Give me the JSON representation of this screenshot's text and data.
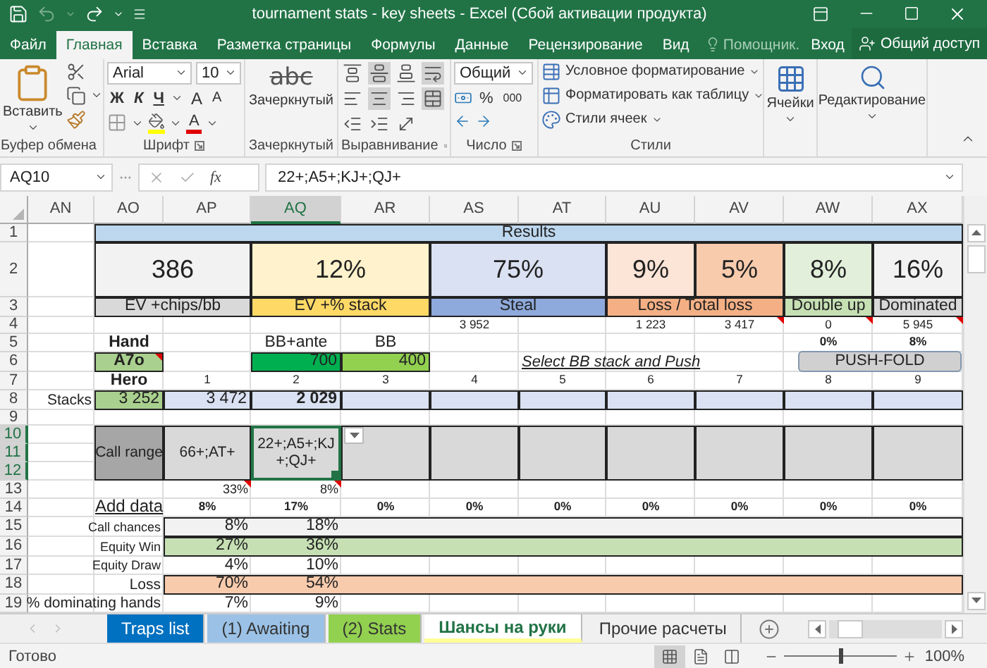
{
  "title_bar": {
    "title": "tournament stats - key sheets - Excel (Сбой активации продукта)"
  },
  "ribbon_tabs": [
    {
      "label": "Файл",
      "selected": false
    },
    {
      "label": "Главная",
      "selected": true
    },
    {
      "label": "Вставка",
      "selected": false
    },
    {
      "label": "Разметка страницы",
      "selected": false
    },
    {
      "label": "Формулы",
      "selected": false
    },
    {
      "label": "Данные",
      "selected": false
    },
    {
      "label": "Рецензирование",
      "selected": false
    },
    {
      "label": "Вид",
      "selected": false
    }
  ],
  "tell_me": "Помощник.",
  "sign_in": "Вход",
  "share": "Общий доступ",
  "ribbon_groups": [
    {
      "kind": "clipboard",
      "label": "Буфер обмена",
      "paste": "Вставить"
    },
    {
      "kind": "font",
      "label": "Шрифт",
      "font": "Arial",
      "size": "10",
      "bold": "Ж",
      "italic": "К",
      "underline": "Ч",
      "grow": "A",
      "shrink": "A",
      "font_color": "A"
    },
    {
      "kind": "style_button",
      "label": "Зачеркнутый",
      "sample": "abc",
      "button": "Зачеркнутый"
    },
    {
      "kind": "alignment",
      "label": "Выравнивание",
      "buttons": [
        {
          "kind": "top",
          "selected": false
        },
        {
          "kind": "middle",
          "selected": true
        },
        {
          "kind": "bottom",
          "selected": false
        },
        {
          "kind": "wrap",
          "selected": true
        },
        {
          "kind": "left",
          "selected": false
        },
        {
          "kind": "center",
          "selected": true
        },
        {
          "kind": "right",
          "selected": false
        },
        {
          "kind": "merge",
          "selected": true
        },
        {
          "kind": "outdent",
          "selected": false
        },
        {
          "kind": "indent",
          "selected": false
        },
        {
          "kind": "orientation",
          "selected": false
        }
      ]
    },
    {
      "kind": "number",
      "label": "Число",
      "format": "Общий",
      "percent": "%",
      "thousands": "000"
    },
    {
      "kind": "styles",
      "label": "Стили",
      "commands": [
        "Условное форматирование",
        "Форматировать как таблицу",
        "Стили ячеек"
      ]
    },
    {
      "kind": "cells",
      "button": "Ячейки"
    },
    {
      "kind": "editing",
      "button": "Редактирование"
    }
  ],
  "formula_bar": {
    "name_box": "AQ10",
    "function_label": "fx",
    "formula": "22+;A5+;KJ+;QJ+"
  },
  "sheet": {
    "columns": [
      {
        "label": "AN",
        "selected": false
      },
      {
        "label": "AO",
        "selected": false
      },
      {
        "label": "AP",
        "selected": false
      },
      {
        "label": "AQ",
        "selected": true
      },
      {
        "label": "AR",
        "selected": false
      },
      {
        "label": "AS",
        "selected": false
      },
      {
        "label": "AT",
        "selected": false
      },
      {
        "label": "AU",
        "selected": false
      },
      {
        "label": "AV",
        "selected": false
      },
      {
        "label": "AW",
        "selected": false
      },
      {
        "label": "AX",
        "selected": false
      }
    ],
    "rows": [
      {
        "number": "1",
        "selected": false,
        "cells": [
          {
            "kind": "empty"
          },
          {
            "kind": "banner",
            "text": "Results",
            "color": "#bdd7ee"
          },
          {
            "kind": "merged"
          },
          {
            "kind": "merged"
          },
          {
            "kind": "merged"
          },
          {
            "kind": "merged"
          },
          {
            "kind": "merged"
          },
          {
            "kind": "merged"
          },
          {
            "kind": "merged"
          },
          {
            "kind": "merged"
          },
          {
            "kind": "merged"
          }
        ]
      },
      {
        "number": "2",
        "selected": false,
        "cells": [
          {
            "kind": "empty"
          },
          {
            "kind": "big",
            "text": "386",
            "color": "#f2f2f2"
          },
          {
            "kind": "merged"
          },
          {
            "kind": "big",
            "text": "12%",
            "color": "#fff2cc"
          },
          {
            "kind": "merged"
          },
          {
            "kind": "big",
            "text": "75%",
            "color": "#d9e1f2"
          },
          {
            "kind": "merged"
          },
          {
            "kind": "big",
            "text": "9%",
            "color": "#fce4d6"
          },
          {
            "kind": "big",
            "text": "5%",
            "color": "#f8cbad"
          },
          {
            "kind": "big",
            "text": "8%",
            "color": "#e2efda"
          },
          {
            "kind": "big",
            "text": "16%",
            "color": "#f2f2f2"
          }
        ]
      },
      {
        "number": "3",
        "selected": false,
        "cells": [
          {
            "kind": "empty"
          },
          {
            "kind": "caption",
            "text": "EV +chips/bb",
            "color": "#d9d9d9"
          },
          {
            "kind": "merged"
          },
          {
            "kind": "caption",
            "text": "EV +% stack",
            "color": "#ffd966"
          },
          {
            "kind": "merged"
          },
          {
            "kind": "caption",
            "text": "Steal",
            "color": "#8ea9db"
          },
          {
            "kind": "merged"
          },
          {
            "kind": "caption",
            "text": "Loss / Total loss",
            "color": "#f4b084"
          },
          {
            "kind": "merged"
          },
          {
            "kind": "caption",
            "text": "Double up",
            "color": "#c6e0b4"
          },
          {
            "kind": "caption",
            "text": "Dominated",
            "color": "#d9d9d9"
          }
        ]
      },
      {
        "number": "4",
        "selected": false,
        "cells": [
          {
            "kind": "empty"
          },
          {
            "kind": "empty"
          },
          {
            "kind": "empty"
          },
          {
            "kind": "empty"
          },
          {
            "kind": "empty"
          },
          {
            "kind": "num",
            "text": "3 952"
          },
          {
            "kind": "empty"
          },
          {
            "kind": "num",
            "text": "1 223"
          },
          {
            "kind": "num",
            "text": "3 417",
            "note": true
          },
          {
            "kind": "num",
            "text": "0",
            "note": true
          },
          {
            "kind": "num",
            "text": "5 945",
            "note": true
          }
        ]
      },
      {
        "number": "5",
        "selected": false,
        "cells": [
          {
            "kind": "empty"
          },
          {
            "kind": "text",
            "text": "Hand",
            "bold": true
          },
          {
            "kind": "empty"
          },
          {
            "kind": "text",
            "text": "BB+ante"
          },
          {
            "kind": "text",
            "text": "BB"
          },
          {
            "kind": "empty"
          },
          {
            "kind": "empty"
          },
          {
            "kind": "empty"
          },
          {
            "kind": "empty"
          },
          {
            "kind": "num",
            "text": "0%",
            "bold": true
          },
          {
            "kind": "num",
            "text": "8%",
            "bold": true
          }
        ]
      },
      {
        "number": "6",
        "selected": false,
        "cells": [
          {
            "kind": "empty"
          },
          {
            "kind": "entry",
            "text": "A7o",
            "color": "#a9d08e",
            "bold": true,
            "note": true
          },
          {
            "kind": "empty"
          },
          {
            "kind": "value",
            "text": "700",
            "color": "#00b050"
          },
          {
            "kind": "value",
            "text": "400",
            "color": "#92d050"
          },
          {
            "kind": "empty"
          },
          {
            "kind": "link",
            "text": "Select BB stack and Push"
          },
          {
            "kind": "merged"
          },
          {
            "kind": "merged"
          },
          {
            "kind": "button",
            "text": "PUSH-FOLD"
          },
          {
            "kind": "merged"
          }
        ]
      },
      {
        "number": "7",
        "selected": false,
        "cells": [
          {
            "kind": "empty"
          },
          {
            "kind": "text",
            "text": "Hero",
            "bold": true
          },
          {
            "kind": "num",
            "text": "1"
          },
          {
            "kind": "num",
            "text": "2"
          },
          {
            "kind": "num",
            "text": "3"
          },
          {
            "kind": "num",
            "text": "4"
          },
          {
            "kind": "num",
            "text": "5"
          },
          {
            "kind": "num",
            "text": "6"
          },
          {
            "kind": "num",
            "text": "7"
          },
          {
            "kind": "num",
            "text": "8"
          },
          {
            "kind": "num",
            "text": "9"
          }
        ]
      },
      {
        "number": "8",
        "selected": false,
        "cells": [
          {
            "kind": "label",
            "text": "Stacks"
          },
          {
            "kind": "value",
            "text": "3 252",
            "color": "#a9d08e"
          },
          {
            "kind": "value",
            "text": "3 472",
            "color": "#d9e1f2"
          },
          {
            "kind": "value",
            "text": "2 029",
            "color": "#d9e1f2",
            "bold": true
          },
          {
            "kind": "blank",
            "color": "#d9e1f2"
          },
          {
            "kind": "blank",
            "color": "#d9e1f2"
          },
          {
            "kind": "blank",
            "color": "#d9e1f2"
          },
          {
            "kind": "blank",
            "color": "#d9e1f2"
          },
          {
            "kind": "blank",
            "color": "#d9e1f2"
          },
          {
            "kind": "blank",
            "color": "#d9e1f2"
          },
          {
            "kind": "blank",
            "color": "#d9e1f2"
          }
        ]
      },
      {
        "number": "9",
        "selected": false,
        "cells": []
      },
      {
        "number": "10",
        "selected": true,
        "cells": [
          {
            "kind": "empty"
          },
          {
            "kind": "range_label",
            "text": "Call range",
            "color": "#a6a6a6"
          },
          {
            "kind": "range",
            "text": "66+;AT+",
            "color": "#d9d9d9"
          },
          {
            "kind": "range",
            "text": "22+;A5+;KJ+;QJ+",
            "color": "#d9d9d9",
            "active": true
          },
          {
            "kind": "range",
            "color": "#d9d9d9"
          },
          {
            "kind": "range",
            "color": "#d9d9d9"
          },
          {
            "kind": "range",
            "color": "#d9d9d9"
          },
          {
            "kind": "range",
            "color": "#d9d9d9"
          },
          {
            "kind": "range",
            "color": "#d9d9d9"
          },
          {
            "kind": "range",
            "color": "#d9d9d9"
          },
          {
            "kind": "range",
            "color": "#d9d9d9"
          }
        ]
      },
      {
        "number": "11",
        "selected": true,
        "cells": []
      },
      {
        "number": "12",
        "selected": true,
        "cells": []
      },
      {
        "number": "13",
        "selected": false,
        "cells": [
          {
            "kind": "empty"
          },
          {
            "kind": "empty"
          },
          {
            "kind": "small",
            "text": "33%",
            "note": true
          },
          {
            "kind": "small",
            "text": "8%",
            "note": true
          }
        ]
      },
      {
        "number": "14",
        "selected": false,
        "cells": [
          {
            "kind": "empty"
          },
          {
            "kind": "add",
            "text": "Add data"
          },
          {
            "kind": "num",
            "text": "8%",
            "bold": true
          },
          {
            "kind": "num",
            "text": "17%",
            "bold": true
          },
          {
            "kind": "num",
            "text": "0%",
            "bold": true
          },
          {
            "kind": "num",
            "text": "0%",
            "bold": true
          },
          {
            "kind": "num",
            "text": "0%",
            "bold": true
          },
          {
            "kind": "num",
            "text": "0%",
            "bold": true
          },
          {
            "kind": "num",
            "text": "0%",
            "bold": true
          },
          {
            "kind": "num",
            "text": "0%",
            "bold": true
          },
          {
            "kind": "num",
            "text": "0%",
            "bold": true
          }
        ]
      },
      {
        "number": "15",
        "selected": false,
        "band": {
          "color": "#f2f2f2"
        },
        "cells": [
          {
            "kind": "empty"
          },
          {
            "kind": "small",
            "text": "Call chances"
          },
          {
            "kind": "pct",
            "text": "8%"
          },
          {
            "kind": "pct",
            "text": "18%"
          }
        ]
      },
      {
        "number": "16",
        "selected": false,
        "band": {
          "color": "#c6e0b4"
        },
        "cells": [
          {
            "kind": "empty"
          },
          {
            "kind": "small",
            "text": "Equity Win"
          },
          {
            "kind": "pct",
            "text": "27%"
          },
          {
            "kind": "pct",
            "text": "36%"
          }
        ]
      },
      {
        "number": "17",
        "selected": false,
        "cells": [
          {
            "kind": "empty"
          },
          {
            "kind": "small",
            "text": "Equity Draw"
          },
          {
            "kind": "pct",
            "text": "4%"
          },
          {
            "kind": "pct",
            "text": "10%"
          }
        ]
      },
      {
        "number": "18",
        "selected": false,
        "band": {
          "color": "#f8cbad"
        },
        "cells": [
          {
            "kind": "empty"
          },
          {
            "kind": "label",
            "text": "Loss"
          },
          {
            "kind": "pct",
            "text": "70%"
          },
          {
            "kind": "pct",
            "text": "54%"
          }
        ]
      },
      {
        "number": "19",
        "selected": false,
        "cells": [
          {
            "kind": "label",
            "text": "% dominating hands"
          },
          {
            "kind": "merged"
          },
          {
            "kind": "pct",
            "text": "7%"
          },
          {
            "kind": "pct",
            "text": "9%"
          }
        ]
      }
    ]
  },
  "sheet_tabs": [
    {
      "label": "Traps list",
      "color": "#0070c0",
      "selected": false
    },
    {
      "label": "(1) Awaiting",
      "color": "#9bc2e6",
      "selected": false
    },
    {
      "label": "(2) Stats",
      "color": "#92d050",
      "selected": false
    },
    {
      "label": "Шансы на руки",
      "color": "#ffff99",
      "selected": true
    },
    {
      "label": "Прочие расчеты",
      "selected": false
    }
  ],
  "status_bar": {
    "text": "Готово",
    "views": [
      {
        "kind": "normal",
        "selected": true
      },
      {
        "kind": "page_layout",
        "selected": false
      },
      {
        "kind": "page_break",
        "selected": false
      }
    ],
    "zoom_slider": {
      "level": 0.5
    },
    "zoom": "100%"
  }
}
